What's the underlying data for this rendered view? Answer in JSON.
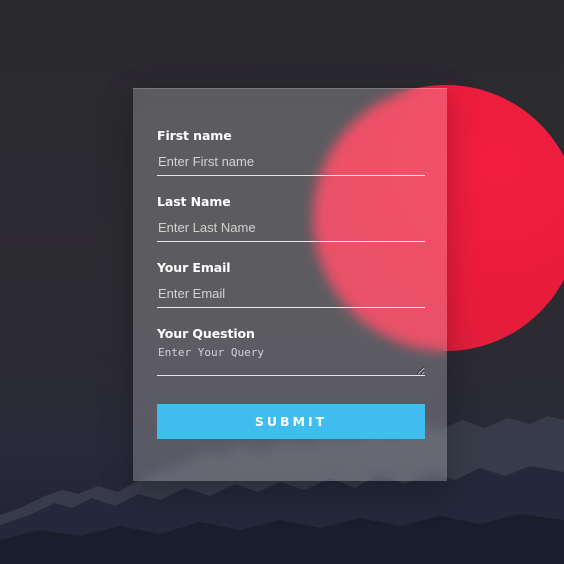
{
  "theme": {
    "accent": "#3fbdee",
    "sun": "#ee1d3b",
    "background": "#2b2a2f"
  },
  "form": {
    "first_name": {
      "label": "First name",
      "placeholder": "Enter First name",
      "value": ""
    },
    "last_name": {
      "label": "Last Name",
      "placeholder": "Enter Last Name",
      "value": ""
    },
    "email": {
      "label": "Your Email",
      "placeholder": "Enter Email",
      "value": ""
    },
    "question": {
      "label": "Your Question",
      "placeholder": "Enter Your Query",
      "value": ""
    },
    "submit_label": "SUBMIT"
  }
}
